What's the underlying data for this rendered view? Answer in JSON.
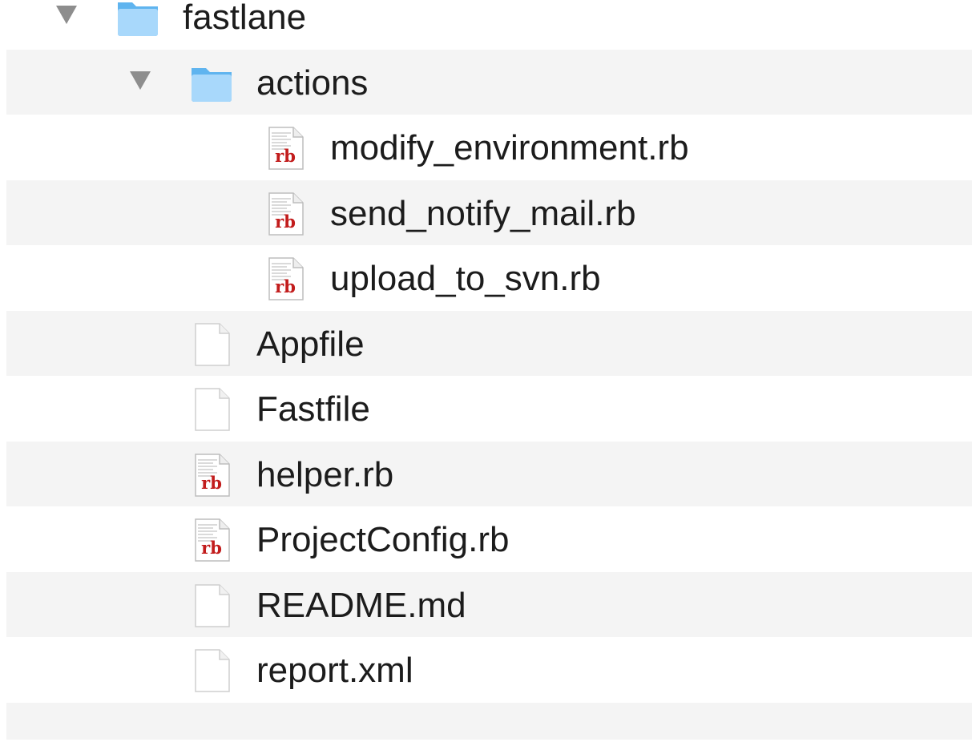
{
  "tree": {
    "rows": [
      {
        "name": "fastlane",
        "kind": "folder",
        "depth": 0,
        "expanded": true,
        "icon": "folder-icon"
      },
      {
        "name": "actions",
        "kind": "folder",
        "depth": 1,
        "expanded": true,
        "icon": "folder-icon"
      },
      {
        "name": "modify_environment.rb",
        "kind": "ruby",
        "depth": 2,
        "icon": "ruby-file-icon",
        "badge": "rb"
      },
      {
        "name": "send_notify_mail.rb",
        "kind": "ruby",
        "depth": 2,
        "icon": "ruby-file-icon",
        "badge": "rb"
      },
      {
        "name": "upload_to_svn.rb",
        "kind": "ruby",
        "depth": 2,
        "icon": "ruby-file-icon",
        "badge": "rb"
      },
      {
        "name": "Appfile",
        "kind": "file",
        "depth": 1,
        "icon": "document-icon"
      },
      {
        "name": "Fastfile",
        "kind": "file",
        "depth": 1,
        "icon": "document-icon"
      },
      {
        "name": "helper.rb",
        "kind": "ruby",
        "depth": 1,
        "icon": "ruby-file-icon",
        "badge": "rb"
      },
      {
        "name": "ProjectConfig.rb",
        "kind": "ruby",
        "depth": 1,
        "icon": "ruby-file-icon",
        "badge": "rb"
      },
      {
        "name": "README.md",
        "kind": "file",
        "depth": 1,
        "icon": "document-icon"
      },
      {
        "name": "report.xml",
        "kind": "file",
        "depth": 1,
        "icon": "document-icon"
      }
    ]
  },
  "colors": {
    "row_alt": "#f4f4f4",
    "folder_light": "#a8d8fb",
    "folder_dark": "#5fb4ef",
    "ruby_red": "#c21c1c",
    "disclosure": "#8d8d8d"
  }
}
